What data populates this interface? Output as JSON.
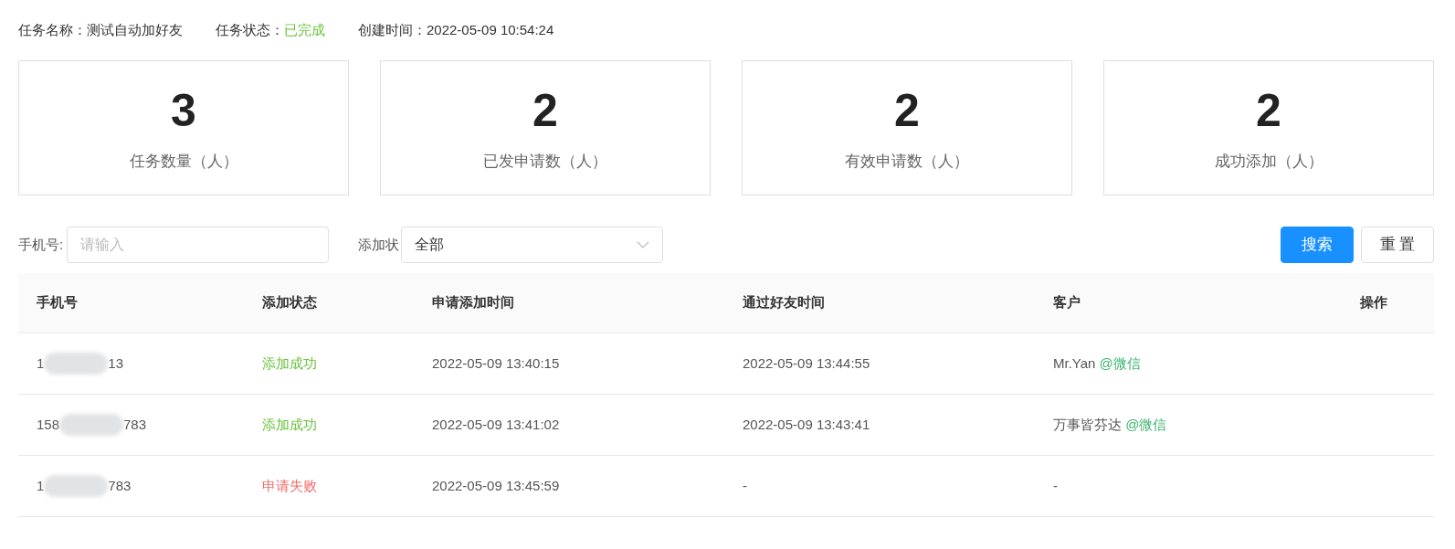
{
  "task_info": [
    {
      "label": "任务名称：",
      "value": "测试自动加好友",
      "kind": "plain"
    },
    {
      "label": "任务状态：",
      "value": "已完成",
      "kind": "status"
    },
    {
      "label": "创建时间：",
      "value": "2022-05-09 10:54:24",
      "kind": "plain"
    }
  ],
  "stats": [
    {
      "value": "3",
      "label": "任务数量（人）"
    },
    {
      "value": "2",
      "label": "已发申请数（人）"
    },
    {
      "value": "2",
      "label": "有效申请数（人）"
    },
    {
      "value": "2",
      "label": "成功添加（人）"
    }
  ],
  "filters": {
    "phone_label": "手机号:",
    "phone_placeholder": "请输入",
    "status_label": "添加状",
    "status_value": "全部"
  },
  "buttons": [
    {
      "label": "搜索",
      "kind": "primary"
    },
    {
      "label": "重 置",
      "kind": "default"
    }
  ],
  "table": {
    "columns": [
      "手机号",
      "添加状态",
      "申请添加时间",
      "通过好友时间",
      "客户",
      "操作"
    ],
    "rows": [
      {
        "phone_start": "1",
        "phone_end": "13",
        "status": "添加成功",
        "kind": "success",
        "applied": "2022-05-09 13:40:15",
        "passed": "2022-05-09 13:44:55",
        "customer": "Mr.Yan",
        "customer_tag": "@微信"
      },
      {
        "phone_start": "158",
        "phone_end": "783",
        "status": "添加成功",
        "kind": "success",
        "applied": "2022-05-09 13:41:02",
        "passed": "2022-05-09 13:43:41",
        "customer": "万事皆芬达",
        "customer_tag": "@微信"
      },
      {
        "phone_start": "1",
        "phone_end": "783",
        "status": "申请失败",
        "kind": "fail",
        "applied": "2022-05-09 13:45:59",
        "passed": "-",
        "customer": "-"
      }
    ]
  }
}
